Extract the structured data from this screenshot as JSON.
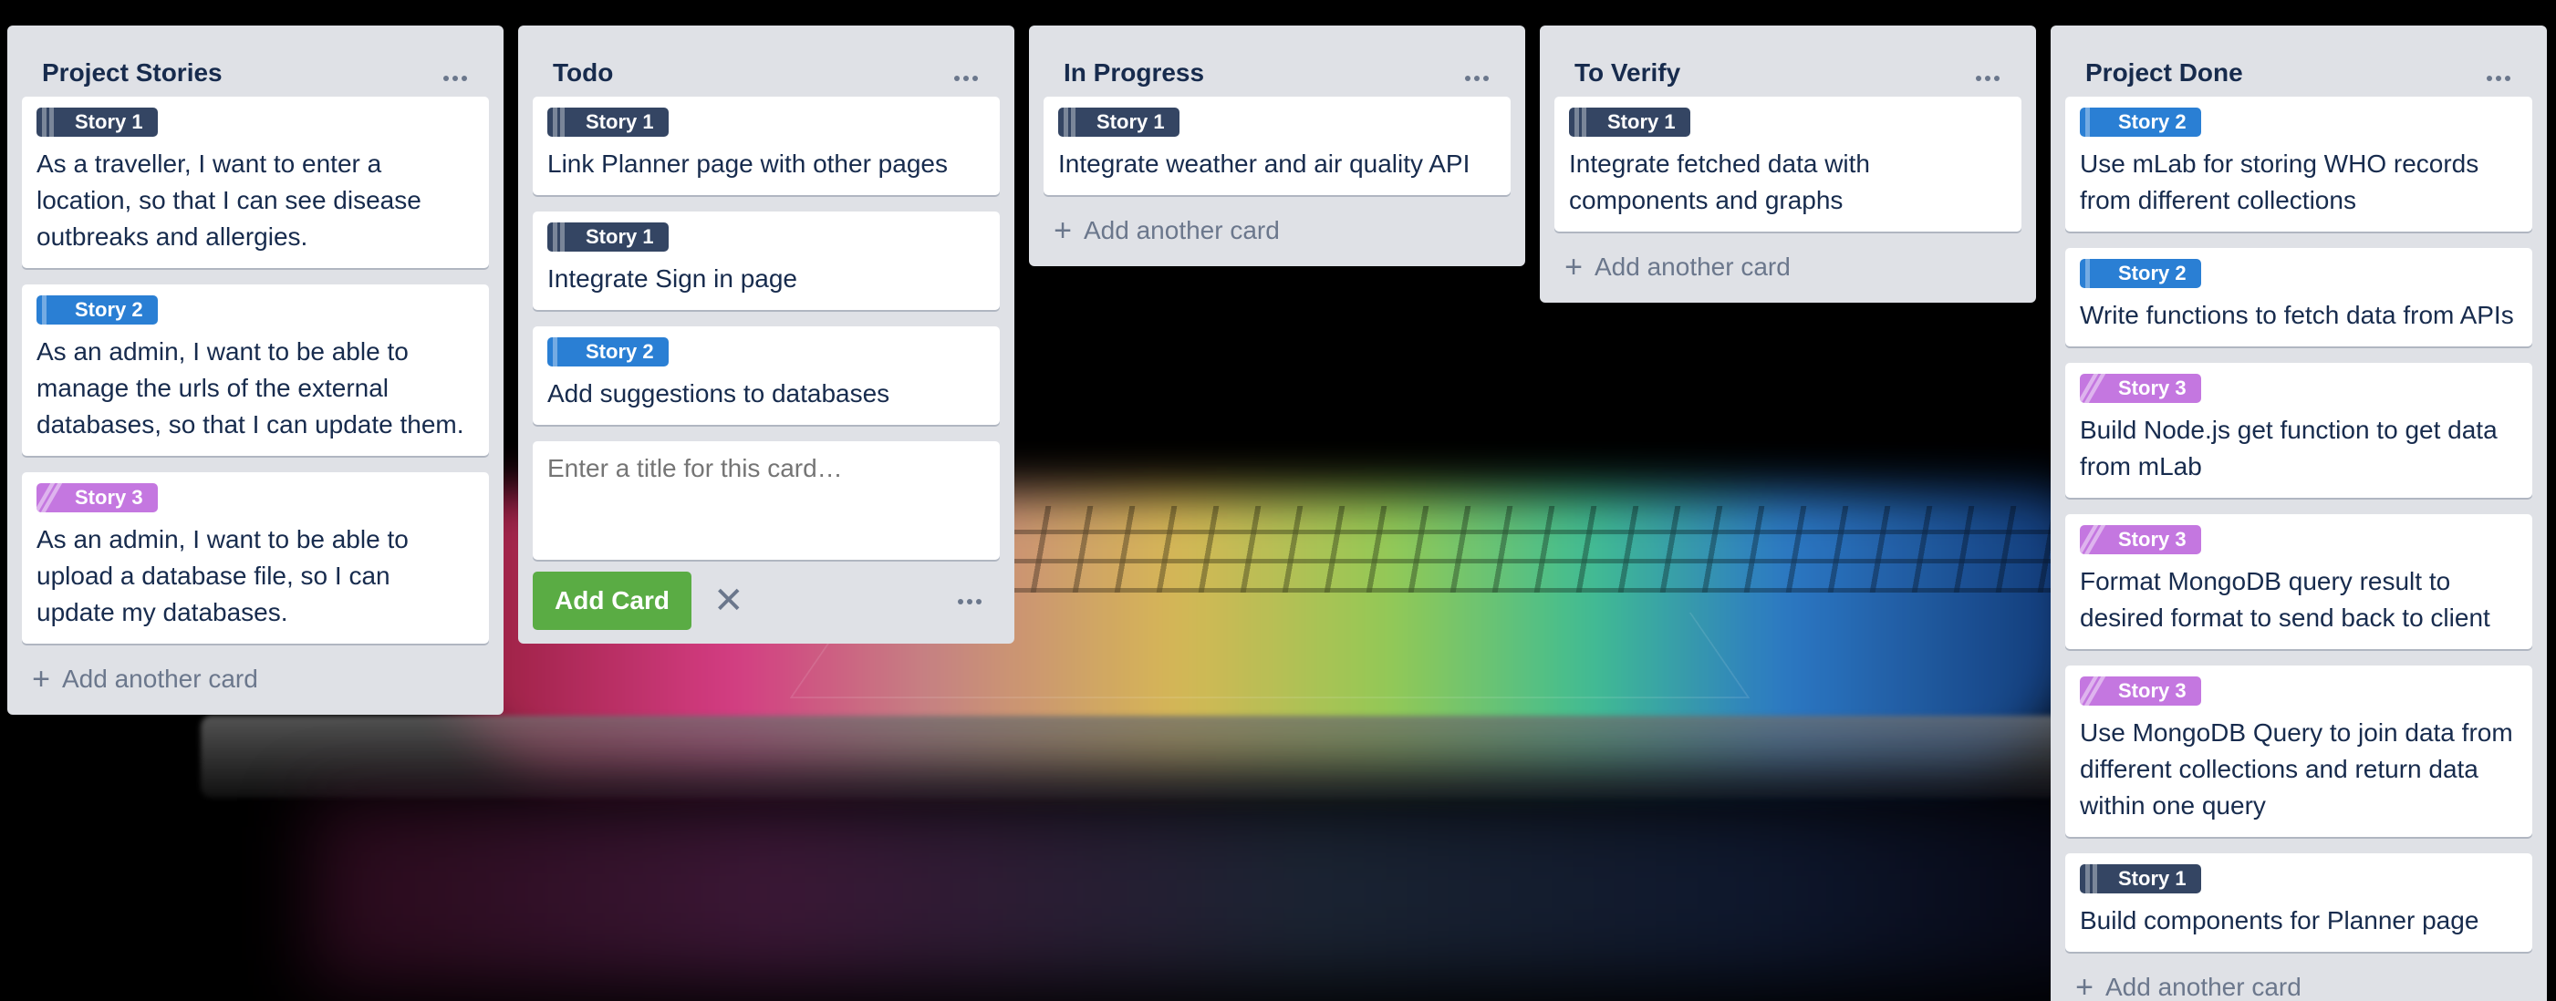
{
  "board": {
    "add_card_label": "Add another card",
    "colors": {
      "list_bg": "#dfe1e6",
      "label_story1": "#344563",
      "label_story2": "#2a7fd4",
      "label_story3": "#c477e0",
      "add_button": "#5aac44"
    },
    "lists": [
      {
        "title": "Project Stories",
        "cards": [
          {
            "label": "Story 1",
            "text": "As a traveller, I want to enter a location, so that I can see disease outbreaks and allergies."
          },
          {
            "label": "Story 2",
            "text": "As an admin, I want to be able to manage the urls of the external databases, so that I can update them."
          },
          {
            "label": "Story 3",
            "text": "As an admin, I want to be able to upload a database file, so I can update my databases."
          }
        ]
      },
      {
        "title": "Todo",
        "cards": [
          {
            "label": "Story 1",
            "text": "Link Planner page with other pages"
          },
          {
            "label": "Story 1",
            "text": "Integrate Sign in page"
          },
          {
            "label": "Story 2",
            "text": "Add suggestions to databases"
          }
        ],
        "composer": {
          "placeholder": "Enter a title for this card…",
          "add_button": "Add Card"
        }
      },
      {
        "title": "In Progress",
        "cards": [
          {
            "label": "Story 1",
            "text": "Integrate weather and air quality API"
          }
        ]
      },
      {
        "title": "To Verify",
        "cards": [
          {
            "label": "Story 1",
            "text": "Integrate fetched data with components and graphs"
          }
        ]
      },
      {
        "title": "Project Done",
        "cards": [
          {
            "label": "Story 2",
            "text": "Use mLab for storing WHO records from different collections"
          },
          {
            "label": "Story 2",
            "text": "Write functions to fetch data from APIs"
          },
          {
            "label": "Story 3",
            "text": "Build Node.js get function to get data from mLab"
          },
          {
            "label": "Story 3",
            "text": "Format MongoDB query result to desired format to send back to client"
          },
          {
            "label": "Story 3",
            "text": "Use MongoDB Query to join data from different collections and return data within one query"
          },
          {
            "label": "Story 1",
            "text": "Build components for Planner page"
          }
        ]
      }
    ]
  }
}
